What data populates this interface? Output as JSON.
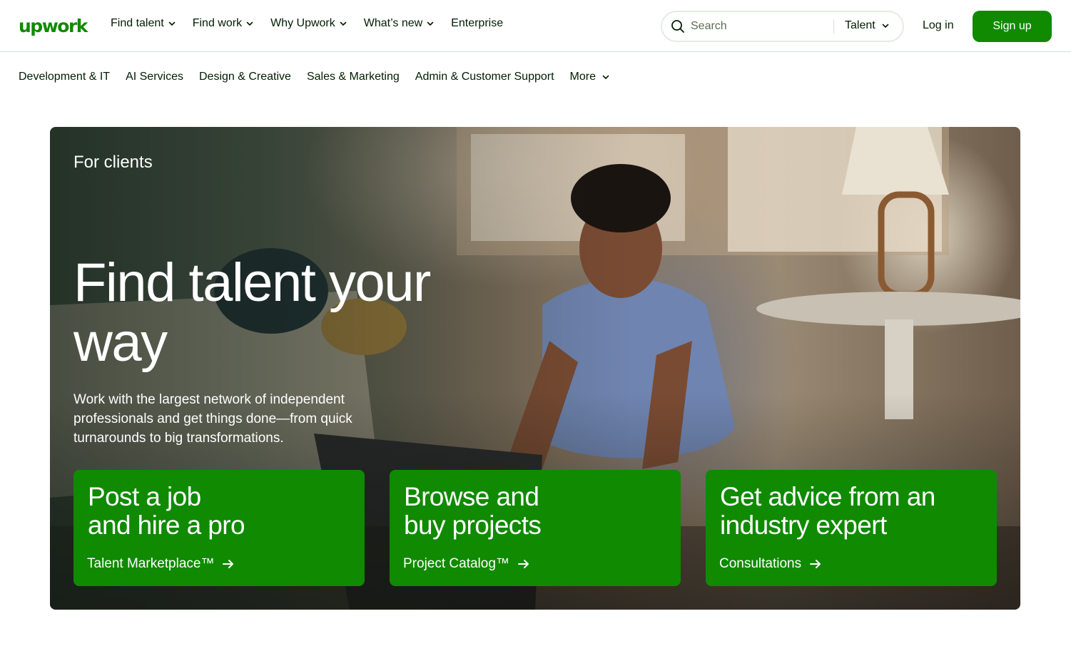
{
  "header": {
    "logo_text": "upwork",
    "nav": [
      {
        "label": "Find talent",
        "has_dropdown": true
      },
      {
        "label": "Find work",
        "has_dropdown": true
      },
      {
        "label": "Why Upwork",
        "has_dropdown": true
      },
      {
        "label": "What’s new",
        "has_dropdown": true
      },
      {
        "label": "Enterprise",
        "has_dropdown": false
      }
    ],
    "search": {
      "placeholder": "Search",
      "type_label": "Talent"
    },
    "login_label": "Log in",
    "signup_label": "Sign up"
  },
  "categories": [
    "Development & IT",
    "AI Services",
    "Design & Creative",
    "Sales & Marketing",
    "Admin & Customer Support",
    "More"
  ],
  "hero": {
    "eyebrow": "For clients",
    "headline": "Find talent your way",
    "subtitle": "Work with the largest network of independent professionals and get things done—from quick turnarounds to big transformations.",
    "cards": [
      {
        "title": "Post a job\nand hire a pro",
        "link": "Talent Marketplace™"
      },
      {
        "title": "Browse and\nbuy projects",
        "link": "Project Catalog™"
      },
      {
        "title": "Get advice from an\nindustry expert",
        "link": "Consultations"
      }
    ]
  },
  "colors": {
    "brand_green": "#108a00",
    "text_dark": "#001e00",
    "white": "#ffffff"
  },
  "icons": [
    "search-icon",
    "chevron-down-icon",
    "arrow-right-icon"
  ]
}
